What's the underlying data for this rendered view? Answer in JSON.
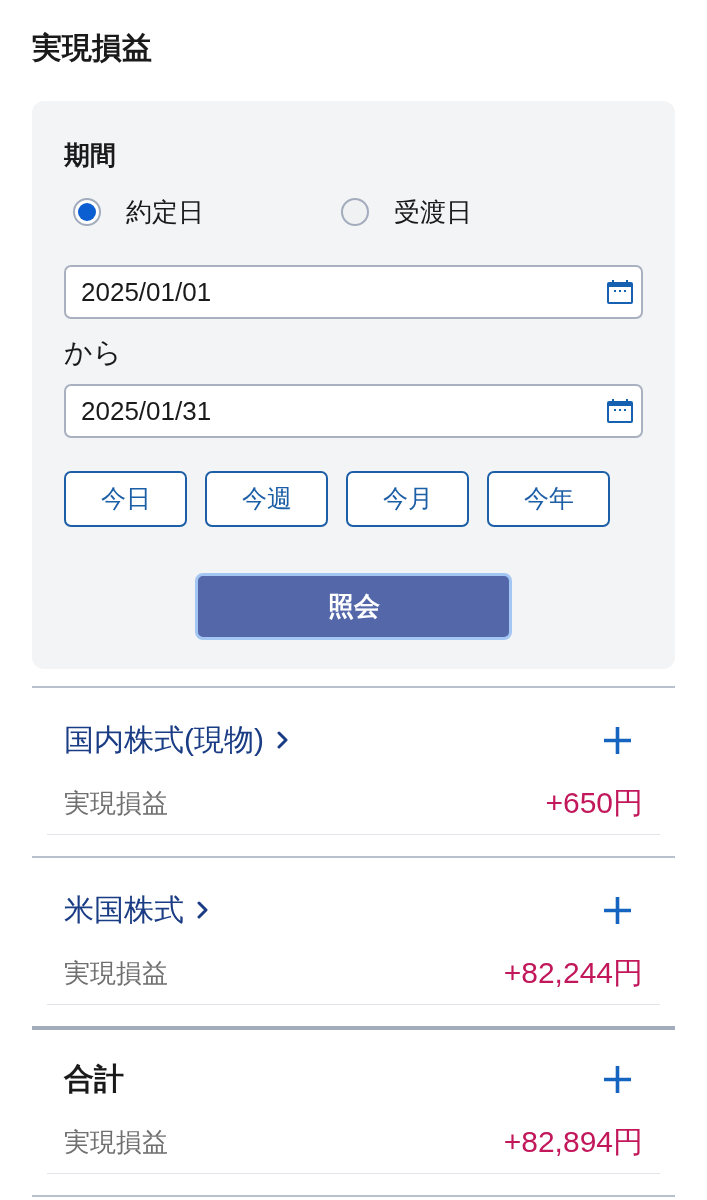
{
  "page_title": "実現損益",
  "filter": {
    "period_label": "期間",
    "date_basis": [
      {
        "label": "約定日",
        "selected": true
      },
      {
        "label": "受渡日",
        "selected": false
      }
    ],
    "start_date": {
      "value": "2025/01/01"
    },
    "range_connector": "から",
    "end_date": {
      "value": "2025/01/31"
    },
    "quick_ranges": [
      {
        "label": "今日"
      },
      {
        "label": "今週"
      },
      {
        "label": "今月"
      },
      {
        "label": "今年"
      }
    ],
    "submit_button": "照会"
  },
  "sections": [
    {
      "kind": "category",
      "title": "国内株式(現物)",
      "expanded": false,
      "rows": [
        {
          "label": "実現損益",
          "value": "+650円"
        }
      ]
    },
    {
      "kind": "category",
      "title": "米国株式",
      "expanded": false,
      "rows": [
        {
          "label": "実現損益",
          "value": "+82,244円"
        }
      ]
    },
    {
      "kind": "total",
      "title": "合計",
      "expanded": false,
      "rows": [
        {
          "label": "実現損益",
          "value": "+82,894円"
        }
      ]
    }
  ]
}
